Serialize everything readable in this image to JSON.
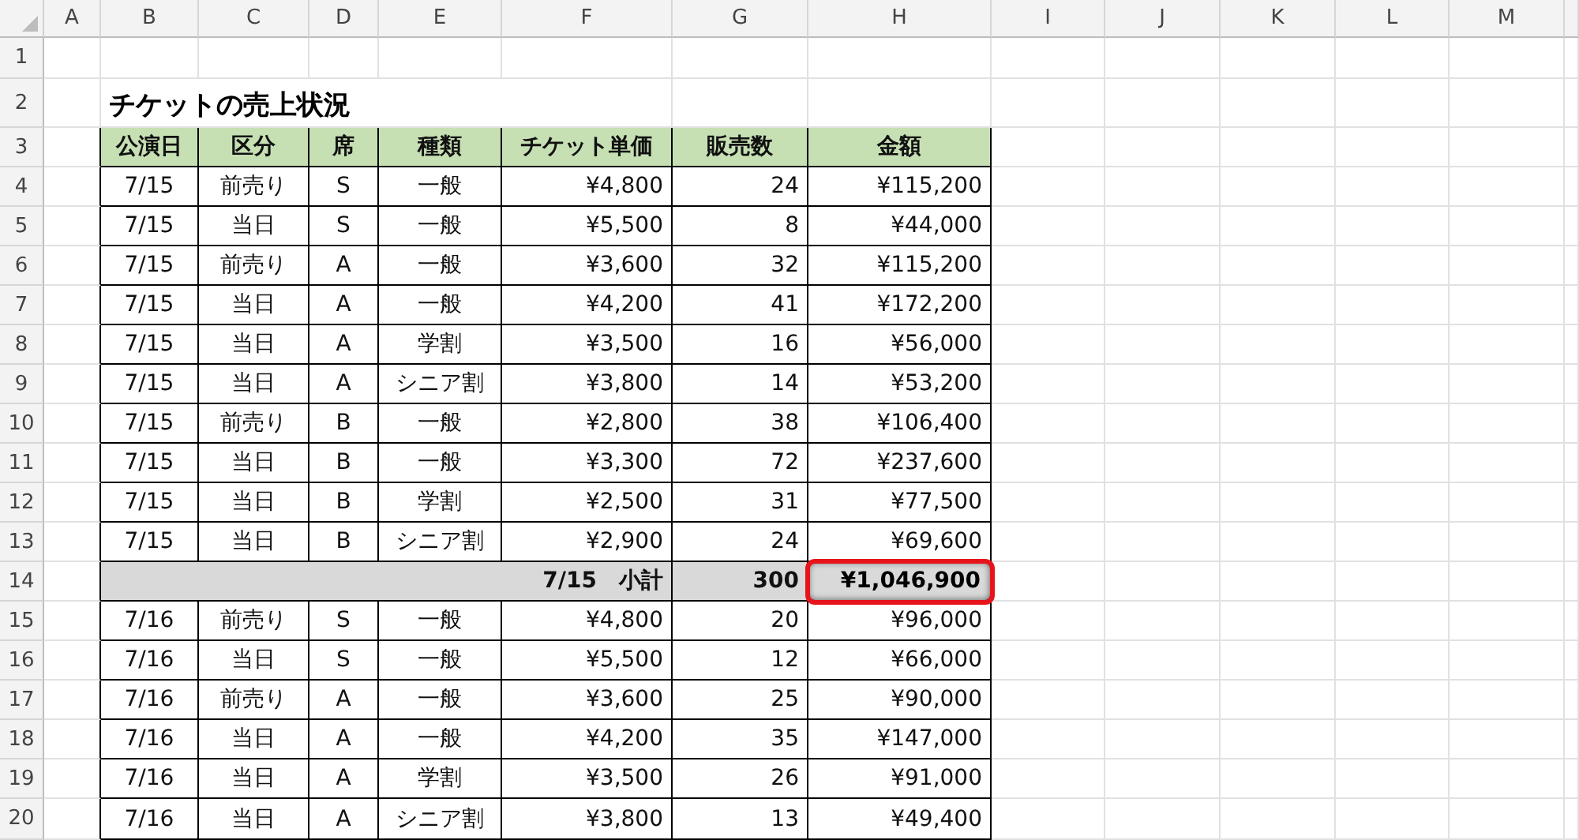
{
  "sheet": {
    "column_letters": [
      "A",
      "B",
      "C",
      "D",
      "E",
      "F",
      "G",
      "H",
      "I",
      "J",
      "K",
      "L",
      "M"
    ],
    "row_numbers": [
      "1",
      "2",
      "3",
      "4",
      "5",
      "6",
      "7",
      "8",
      "9",
      "10",
      "11",
      "12",
      "13",
      "14",
      "15",
      "16",
      "17",
      "18",
      "19",
      "20"
    ],
    "title": "チケットの売上状況",
    "table": {
      "columns": [
        "公演日",
        "区分",
        "席",
        "種類",
        "チケット単価",
        "販売数",
        "金額"
      ],
      "rows": [
        {
          "kind": "data",
          "cells": [
            "7/15",
            "前売り",
            "S",
            "一般",
            "¥4,800",
            "24",
            "¥115,200"
          ]
        },
        {
          "kind": "data",
          "cells": [
            "7/15",
            "当日",
            "S",
            "一般",
            "¥5,500",
            "8",
            "¥44,000"
          ]
        },
        {
          "kind": "data",
          "cells": [
            "7/15",
            "前売り",
            "A",
            "一般",
            "¥3,600",
            "32",
            "¥115,200"
          ]
        },
        {
          "kind": "data",
          "cells": [
            "7/15",
            "当日",
            "A",
            "一般",
            "¥4,200",
            "41",
            "¥172,200"
          ]
        },
        {
          "kind": "data",
          "cells": [
            "7/15",
            "当日",
            "A",
            "学割",
            "¥3,500",
            "16",
            "¥56,000"
          ]
        },
        {
          "kind": "data",
          "cells": [
            "7/15",
            "当日",
            "A",
            "シニア割",
            "¥3,800",
            "14",
            "¥53,200"
          ]
        },
        {
          "kind": "data",
          "cells": [
            "7/15",
            "前売り",
            "B",
            "一般",
            "¥2,800",
            "38",
            "¥106,400"
          ]
        },
        {
          "kind": "data",
          "cells": [
            "7/15",
            "当日",
            "B",
            "一般",
            "¥3,300",
            "72",
            "¥237,600"
          ]
        },
        {
          "kind": "data",
          "cells": [
            "7/15",
            "当日",
            "B",
            "学割",
            "¥2,500",
            "31",
            "¥77,500"
          ]
        },
        {
          "kind": "data",
          "cells": [
            "7/15",
            "当日",
            "B",
            "シニア割",
            "¥2,900",
            "24",
            "¥69,600"
          ]
        },
        {
          "kind": "subtotal",
          "label": "7/15　小計",
          "count": "300",
          "amount": "¥1,046,900",
          "highlighted": true
        },
        {
          "kind": "data",
          "cells": [
            "7/16",
            "前売り",
            "S",
            "一般",
            "¥4,800",
            "20",
            "¥96,000"
          ]
        },
        {
          "kind": "data",
          "cells": [
            "7/16",
            "当日",
            "S",
            "一般",
            "¥5,500",
            "12",
            "¥66,000"
          ]
        },
        {
          "kind": "data",
          "cells": [
            "7/16",
            "前売り",
            "A",
            "一般",
            "¥3,600",
            "25",
            "¥90,000"
          ]
        },
        {
          "kind": "data",
          "cells": [
            "7/16",
            "当日",
            "A",
            "一般",
            "¥4,200",
            "35",
            "¥147,000"
          ]
        },
        {
          "kind": "data",
          "cells": [
            "7/16",
            "当日",
            "A",
            "学割",
            "¥3,500",
            "26",
            "¥91,000"
          ]
        },
        {
          "kind": "data",
          "cells": [
            "7/16",
            "当日",
            "A",
            "シニア割",
            "¥3,800",
            "13",
            "¥49,400"
          ]
        }
      ]
    }
  }
}
